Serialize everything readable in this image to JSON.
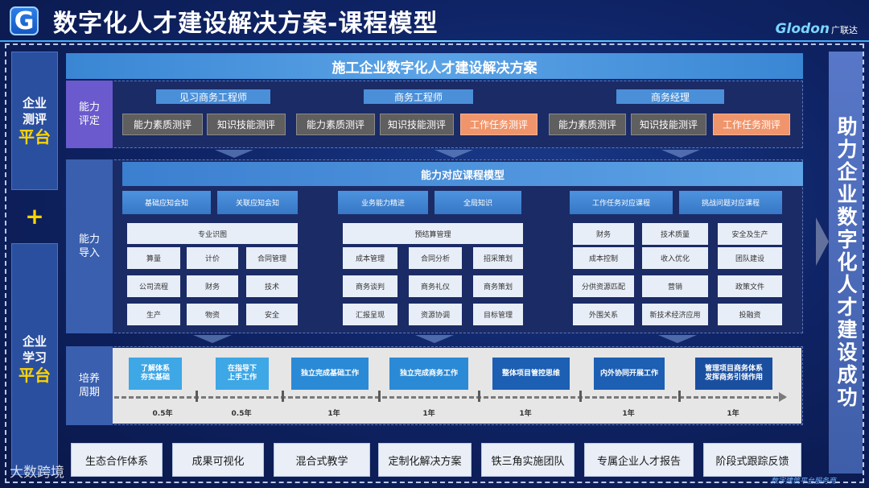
{
  "header": {
    "logo_letter": "G",
    "title": "数字化人才建设解决方案-课程模型",
    "brand": "Glodon",
    "brand_cn": "广联达"
  },
  "left": {
    "top": [
      "企业",
      "测评"
    ],
    "top_em": "平台",
    "plus": "+",
    "bottom": [
      "企业",
      "学习"
    ],
    "bottom_em": "平台"
  },
  "right_banner": "助力企业数字化人才建设成功",
  "top_title": "施工企业数字化人才建设解决方案",
  "assess": {
    "label": [
      "能力",
      "评定"
    ],
    "roles": [
      "见习商务工程师",
      "商务工程师",
      "商务经理"
    ],
    "buttons": [
      "能力素质测评",
      "知识技能测评",
      "能力素质测评",
      "知识技能测评",
      "工作任务测评",
      "能力素质测评",
      "知识技能测评",
      "工作任务测评"
    ]
  },
  "import": {
    "label": [
      "能力",
      "导入"
    ],
    "model_title": "能力对应课程模型",
    "subs": [
      "基础应知会知",
      "关联应知会知",
      "业务能力精进",
      "全局知识",
      "工作任务对应课程",
      "挑战问题对应课程"
    ],
    "group_titles": [
      "专业识图",
      "预结算管理"
    ],
    "col1": [
      "算量",
      "计价",
      "合同管理",
      "公司流程",
      "财务",
      "技术",
      "生产",
      "物资",
      "安全"
    ],
    "col2": [
      "成本管理",
      "合同分析",
      "招采策划",
      "商务谈判",
      "商务礼仪",
      "商务策划",
      "汇报呈现",
      "资源协调",
      "目标管理"
    ],
    "col3": [
      "财务",
      "技术质量",
      "安全及生产",
      "成本控制",
      "收入优化",
      "团队建设",
      "分供资源匹配",
      "营销",
      "政策文件",
      "外围关系",
      "新技术经济应用",
      "投融资"
    ]
  },
  "cultivate": {
    "label": [
      "培养",
      "周期"
    ],
    "stages": [
      [
        "了解体系",
        "夯实基础"
      ],
      [
        "在指导下",
        "上手工作"
      ],
      [
        "独立完成基础工作"
      ],
      [
        "独立完成商务工作"
      ],
      [
        "整体项目管控思维"
      ],
      [
        "内外协同开展工作"
      ],
      [
        "管理项目商务体系",
        "发挥商务引领作用"
      ]
    ],
    "durations": [
      "0.5年",
      "0.5年",
      "1年",
      "1年",
      "1年",
      "1年",
      "1年"
    ]
  },
  "bottom": [
    "生态合作体系",
    "成果可视化",
    "混合式教学",
    "定制化解决方案",
    "铁三角实施团队",
    "专属企业人才报告",
    "阶段式跟踪反馈"
  ],
  "watermarks": [
    "大数跨境",
    "数字建筑平台服务商"
  ]
}
